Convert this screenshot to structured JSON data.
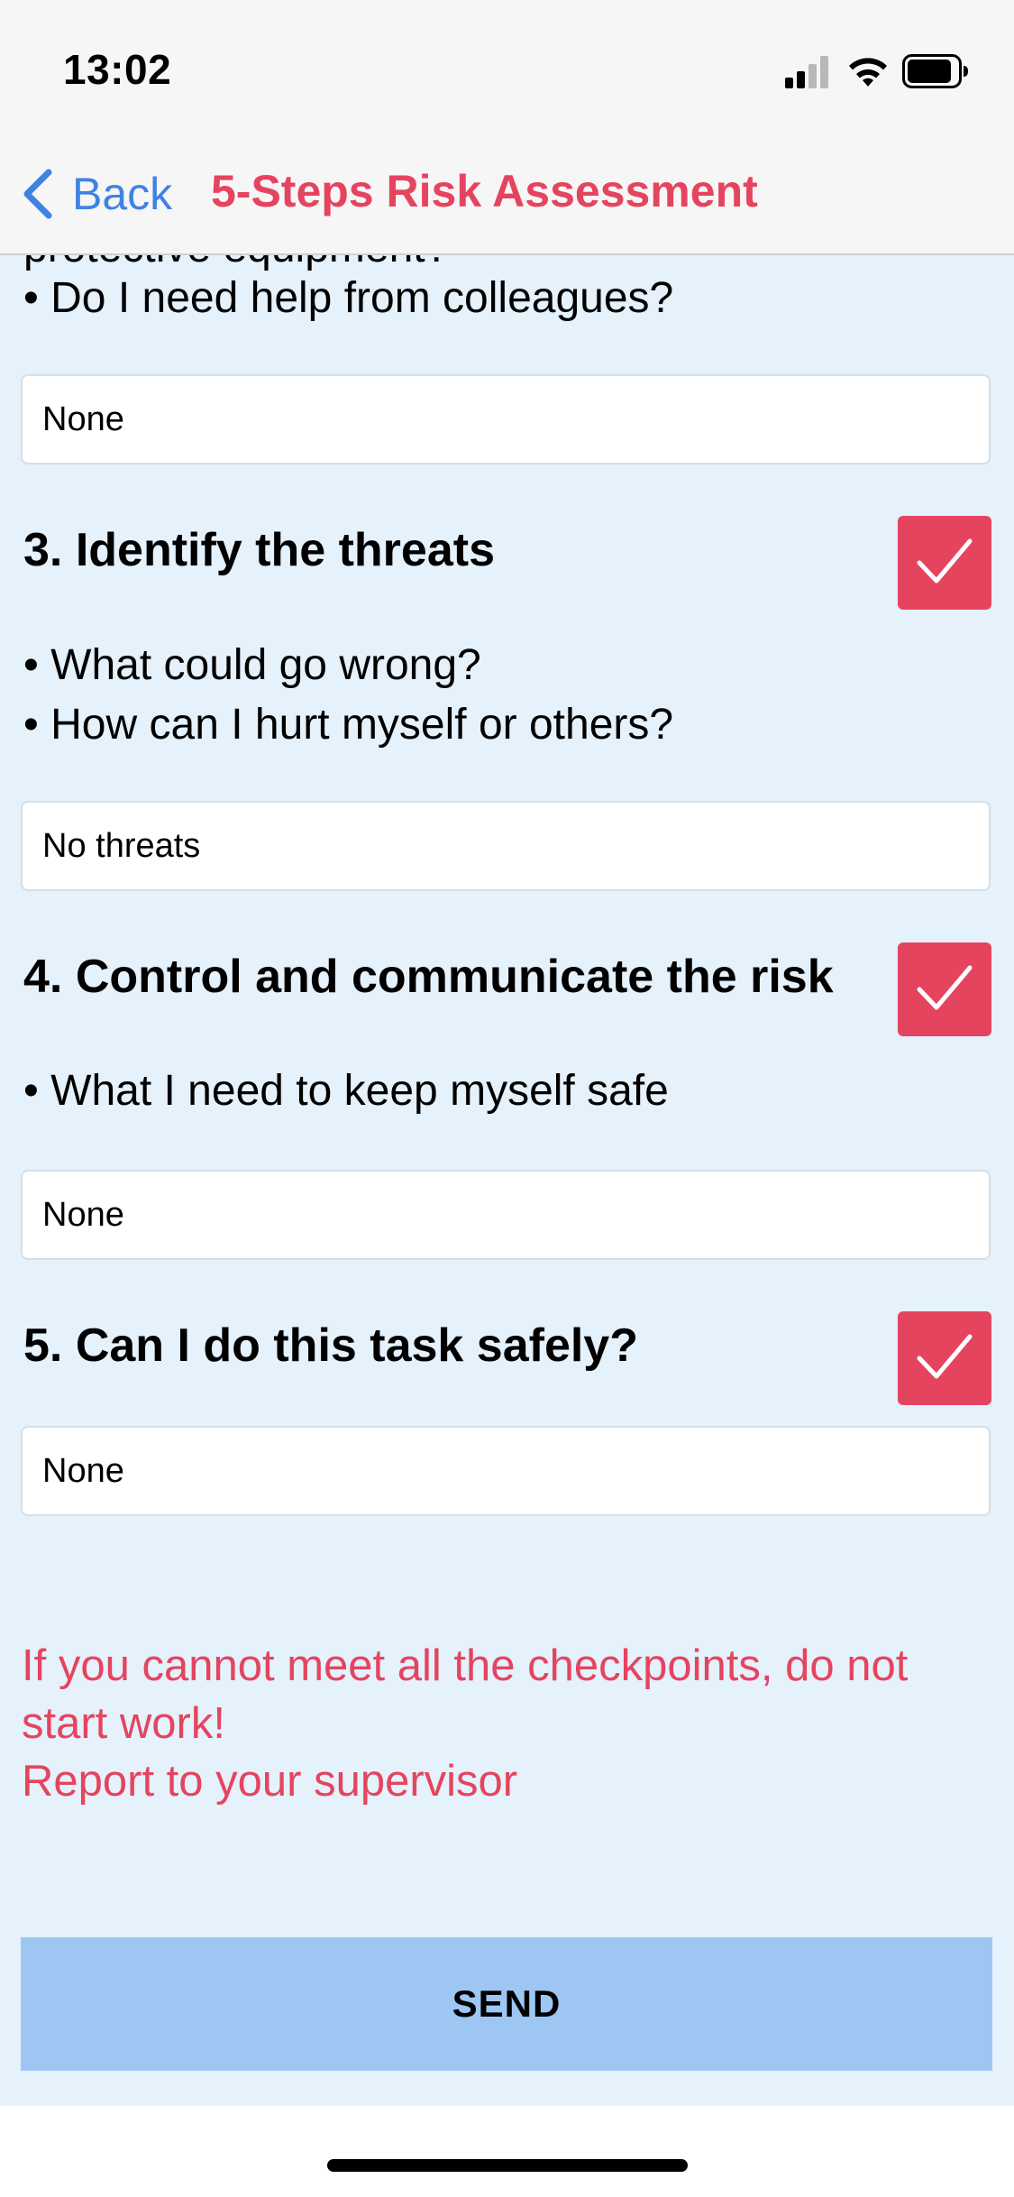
{
  "status_bar": {
    "time": "13:02"
  },
  "nav": {
    "back_label": "Back",
    "title": "5-Steps Risk Assessment"
  },
  "previous_step": {
    "cut_off_text": "protective equipment?",
    "bullets": [
      "• Do I need help from colleagues?"
    ],
    "answer": "None"
  },
  "steps": [
    {
      "heading": "3. Identify the threats",
      "checked": true,
      "bullets": [
        "• What could go wrong?",
        "• How can I hurt myself or others?"
      ],
      "answer": "No threats"
    },
    {
      "heading": "4. Control and communicate the risk",
      "checked": true,
      "bullets": [
        "• What I need to keep myself safe"
      ],
      "answer": "None"
    },
    {
      "heading": "5. Can I do this task safely?",
      "checked": true,
      "bullets": [],
      "answer": "None"
    }
  ],
  "warning": {
    "line1": "If you cannot meet all the checkpoints, do not start work!",
    "line2": "Report to your supervisor"
  },
  "send_label": "SEND",
  "colors": {
    "accent_red": "#e5445f",
    "link_blue": "#3f82e4",
    "content_bg": "#e5f1fb",
    "send_bg": "#9ec6f3"
  }
}
